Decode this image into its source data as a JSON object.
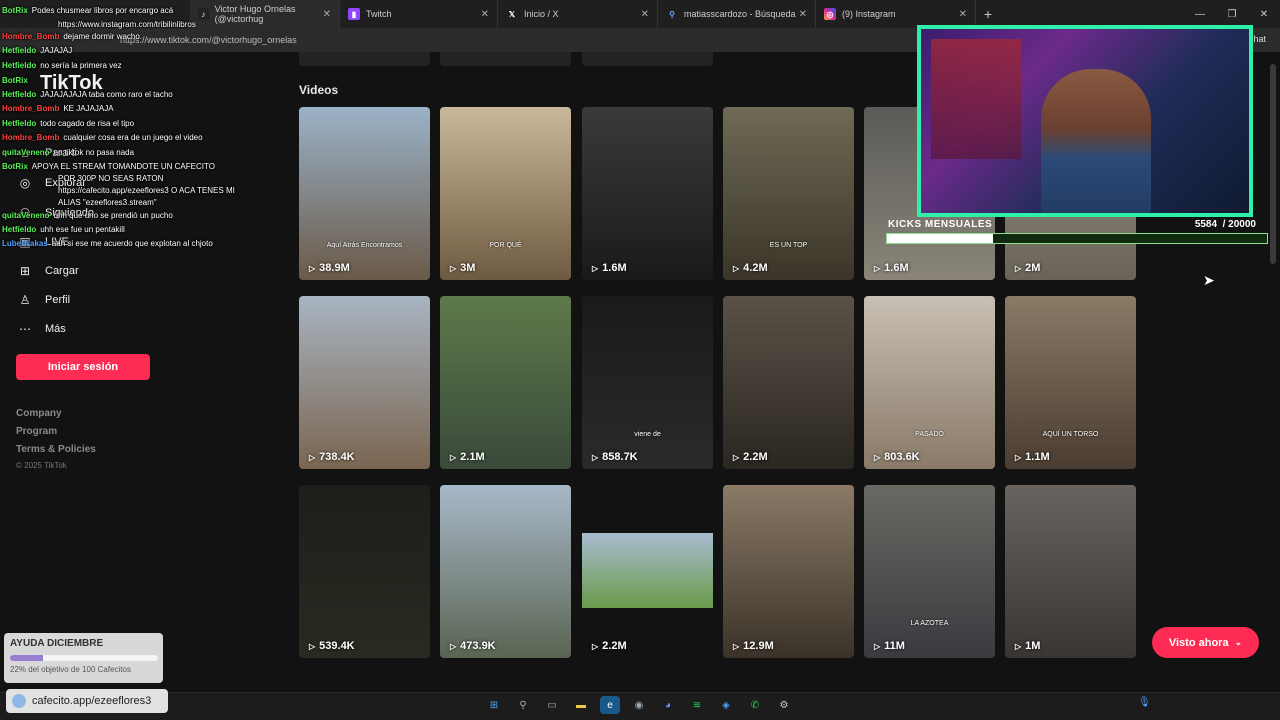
{
  "browser": {
    "tabs": [
      {
        "label": "Victor Hugo Ornelas (@victorhug",
        "icon": "tiktok-icon",
        "active": true
      },
      {
        "label": "Twitch",
        "icon": "twitch-icon"
      },
      {
        "label": "Inicio / X",
        "icon": "x-icon"
      },
      {
        "label": "matiasscardozo - Búsqueda",
        "icon": "search-icon"
      },
      {
        "label": "(9) Instagram",
        "icon": "instagram-icon"
      }
    ],
    "url": "https://www.tiktok.com/@victorhugo_ornelas",
    "chat_label": "Chat"
  },
  "sidebar": {
    "logo": "TikTok",
    "nav": [
      {
        "label": "Para ti",
        "icon": "home-icon"
      },
      {
        "label": "Explorar",
        "icon": "compass-icon"
      },
      {
        "label": "Siguiendo",
        "icon": "following-icon"
      },
      {
        "label": "LIVE",
        "icon": "live-icon"
      },
      {
        "label": "Cargar",
        "icon": "upload-icon"
      },
      {
        "label": "Perfil",
        "icon": "profile-icon"
      },
      {
        "label": "Más",
        "icon": "more-icon"
      }
    ],
    "login": "Iniciar sesión",
    "footer": [
      "Company",
      "Program",
      "Terms & Policies"
    ],
    "copyright": "© 2025 TikTok"
  },
  "chat": [
    {
      "user": "BotRix",
      "msg": "Podes chusmear libros por encargo acá",
      "color": "green"
    },
    {
      "user": "",
      "msg": "https://www.instagram.com/tribilinlibros",
      "color": "green"
    },
    {
      "user": "Hombre_Bomb",
      "msg": "dejame dormir wacho",
      "color": "red"
    },
    {
      "user": "Hetfieldo",
      "msg": "JAJAJAJ",
      "color": "green"
    },
    {
      "user": "Hetfieldo",
      "msg": "no sería la primera vez",
      "color": "green"
    },
    {
      "user": "BotRix",
      "msg": "",
      "color": "green"
    },
    {
      "user": "Hetfieldo",
      "msg": "JAJAJAJAJA taba como raro el tacho",
      "color": "green"
    },
    {
      "user": "Hombre_Bomb",
      "msg": "KE JAJAJAJA",
      "color": "red"
    },
    {
      "user": "Hetfieldo",
      "msg": "todo cagado de risa el tipo",
      "color": "green"
    },
    {
      "user": "Hombre_Bomb",
      "msg": "cualquier cosa era de un juego el video",
      "color": "red"
    },
    {
      "user": "quitaVeneno",
      "msg": "en tiktok no pasa nada",
      "color": "green"
    },
    {
      "user": "BotRix",
      "msg": "APOYA EL STREAM TOMANDOTE UN CAFECITO",
      "color": "green"
    },
    {
      "user": "",
      "msg": "POR 300P NO SEAS RATON",
      "color": "green"
    },
    {
      "user": "",
      "msg": "https://cafecito.app/ezeeflores3 O ACA TENES MI",
      "color": "green"
    },
    {
      "user": "",
      "msg": "ALIAS \"ezeeflores3.stream\"",
      "color": "green"
    },
    {
      "user": "quitaVeneno",
      "msg": "uhh que uno se prendió un pucho",
      "color": "green"
    },
    {
      "user": "Hetfieldo",
      "msg": "uhh ese fue un pentakill",
      "color": "green"
    },
    {
      "user": "LuberNakas",
      "msg": "aah si ese me acuerdo que explotan al chjoto",
      "color": "blue"
    }
  ],
  "main": {
    "section_title": "Videos",
    "videos": [
      {
        "views": "38.9M",
        "caption": "Aquí Atrás Encontramos"
      },
      {
        "views": "3M",
        "caption": "POR QUÉ"
      },
      {
        "views": "1.6M",
        "caption": ""
      },
      {
        "views": "4.2M",
        "caption": "ES UN TOP"
      },
      {
        "views": "1.6M",
        "caption": ""
      },
      {
        "views": "2M",
        "caption": ""
      },
      {
        "views": "738.4K",
        "caption": ""
      },
      {
        "views": "2.1M",
        "caption": ""
      },
      {
        "views": "858.7K",
        "caption": "viene de"
      },
      {
        "views": "2.2M",
        "caption": ""
      },
      {
        "views": "803.6K",
        "caption": "PASADO"
      },
      {
        "views": "1.1M",
        "caption": "AQUÍ UN TORSO"
      },
      {
        "views": "539.4K",
        "caption": ""
      },
      {
        "views": "473.9K",
        "caption": ""
      },
      {
        "views": "2.2M",
        "caption": ""
      },
      {
        "views": "12.9M",
        "caption": ""
      },
      {
        "views": "11M",
        "caption": "LA AZOTEA"
      },
      {
        "views": "1M",
        "caption": ""
      }
    ],
    "visto_ahora": "Visto ahora"
  },
  "overlay": {
    "kicks_label": "KICKS MENSUALES",
    "kicks_value": "5584",
    "kicks_goal": "/ 20000",
    "kicks_fraction": 0.28,
    "ayuda_title": "AYUDA DICIEMBRE",
    "ayuda_text": "22% del objetivo de 100 Cafecitos",
    "ayuda_fraction": 0.22,
    "cafecito_link": "cafecito.app/ezeeflores3"
  },
  "taskbar": {
    "icons": [
      "windows-icon",
      "search-icon",
      "taskview-icon",
      "folder-icon",
      "edge-icon",
      "steam-icon",
      "discord-icon",
      "spotify-icon",
      "vpn-icon",
      "whatsapp-icon",
      "settings-icon"
    ]
  }
}
